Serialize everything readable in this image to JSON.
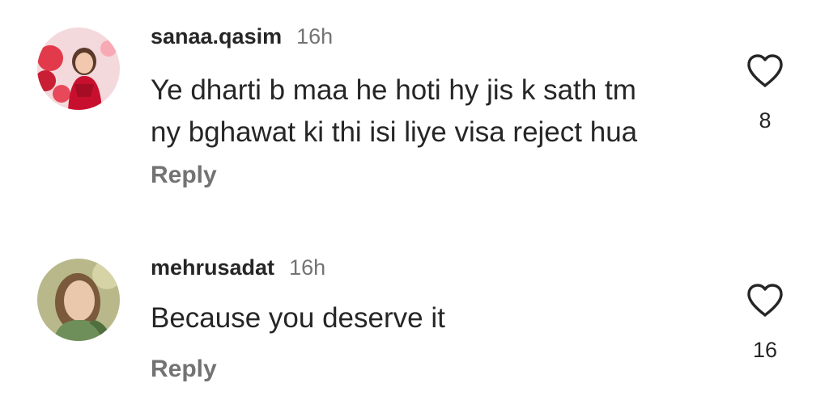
{
  "comments": [
    {
      "username": "sanaa.qasim",
      "time": "16h",
      "lines": [
        "Ye dharti b maa he hoti hy jis k sath tm",
        "ny bghawat ki thi isi liye visa reject hua"
      ],
      "reply_label": "Reply",
      "likes": "8",
      "avatar_icon": "profile-photo-icon",
      "like_icon": "heart-outline-icon"
    },
    {
      "username": "mehrusadat",
      "time": "16h",
      "lines": [
        "Because you deserve it"
      ],
      "reply_label": "Reply",
      "likes": "16",
      "avatar_icon": "profile-photo-icon",
      "like_icon": "heart-outline-icon"
    }
  ],
  "colors": {
    "text_primary": "#262626",
    "text_secondary": "#737373",
    "background": "#ffffff"
  }
}
